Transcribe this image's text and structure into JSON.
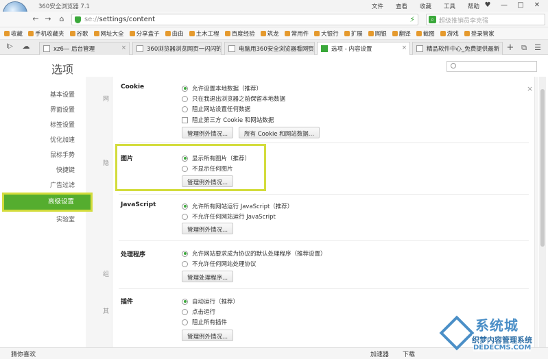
{
  "window": {
    "title": "360安全浏览器 7.1",
    "menu": [
      "文件",
      "查看",
      "收藏",
      "工具",
      "帮助"
    ],
    "controls": [
      "♥",
      "—",
      "□",
      "✕"
    ]
  },
  "nav": {
    "back": "←",
    "forward": "→",
    "home": "⌂",
    "refresh": "↻",
    "url_prefix": "se://",
    "url_path": "settings/content",
    "bolt": "⚡",
    "search_placeholder": "超级推销员李克强"
  },
  "bookmarks": [
    "收藏",
    "手机收藏夹",
    "谷歌",
    "网址大全",
    "分享盒子",
    "由由",
    "土木工程",
    "百度经验",
    "筑龙",
    "常用件",
    "大银行",
    "扩展",
    "网银",
    "翻译",
    "截图",
    "游戏",
    "登录管家"
  ],
  "tabs": [
    {
      "label": "xz6— 后台管理",
      "active": false
    },
    {
      "label": "360浏览器浏览网页一闪闪的",
      "active": false
    },
    {
      "label": "电脑用360安全浏览器看网页",
      "active": false
    },
    {
      "label": "选项 - 内容设置",
      "active": true
    },
    {
      "label": "精品软件中心_免费提供最新",
      "active": false
    }
  ],
  "tab_extras": {
    "add": "+",
    "menu": "☰"
  },
  "page": {
    "title": "选项",
    "search_placeholder": ""
  },
  "sidebar": {
    "items": [
      "基本设置",
      "界面设置",
      "标签设置",
      "优化加速",
      "鼠标手势",
      "快捷键",
      "广告过滤",
      "高级设置",
      "实验室"
    ],
    "active_index": 7
  },
  "bg_labels": [
    "网",
    "隐",
    "组",
    "其"
  ],
  "content": {
    "cookie": {
      "title": "Cookie",
      "options": [
        {
          "label": "允许设置本地数据（推荐）",
          "type": "radio",
          "checked": true
        },
        {
          "label": "只在我退出浏览器之前保留本地数据",
          "type": "radio",
          "checked": false
        },
        {
          "label": "阻止网站设置任何数据",
          "type": "radio",
          "checked": false
        },
        {
          "label": "阻止第三方 Cookie 和网站数据",
          "type": "checkbox",
          "checked": false
        }
      ],
      "buttons": [
        "管理例外情况...",
        "所有 Cookie 和网站数据..."
      ]
    },
    "images": {
      "title": "图片",
      "options": [
        {
          "label": "显示所有图片（推荐）",
          "type": "radio",
          "checked": true
        },
        {
          "label": "不显示任何图片",
          "type": "radio",
          "checked": false
        }
      ],
      "buttons": [
        "管理例外情况..."
      ]
    },
    "javascript": {
      "title": "JavaScript",
      "options": [
        {
          "label": "允许所有网站运行 JavaScript（推荐）",
          "type": "radio",
          "checked": true
        },
        {
          "label": "不允许任何网站运行 JavaScript",
          "type": "radio",
          "checked": false
        }
      ],
      "buttons": [
        "管理例外情况..."
      ]
    },
    "handlers": {
      "title": "处理程序",
      "options": [
        {
          "label": "允许网站要求成为协议的默认处理程序（推荐设置）",
          "type": "radio",
          "checked": true
        },
        {
          "label": "不允许任何网站处理协议",
          "type": "radio",
          "checked": false
        }
      ],
      "buttons": [
        "管理处理程序..."
      ]
    },
    "plugins": {
      "title": "插件",
      "options": [
        {
          "label": "自动运行（推荐）",
          "type": "radio",
          "checked": true
        },
        {
          "label": "点击运行",
          "type": "radio",
          "checked": false
        },
        {
          "label": "阻止所有插件",
          "type": "radio",
          "checked": false
        }
      ],
      "buttons": [
        "管理例外情况..."
      ]
    }
  },
  "close_label": "×",
  "status": {
    "left": "猜你喜欢",
    "right": [
      "加速器",
      "下载"
    ]
  },
  "watermark": {
    "brand": "系统城",
    "line1": "织梦内容管理系统",
    "line2": "DEDECMS.COM"
  },
  "colors": {
    "accent": "#55ad2f",
    "highlight": "#d3dc3c",
    "radio_dot": "#3aa83a"
  }
}
